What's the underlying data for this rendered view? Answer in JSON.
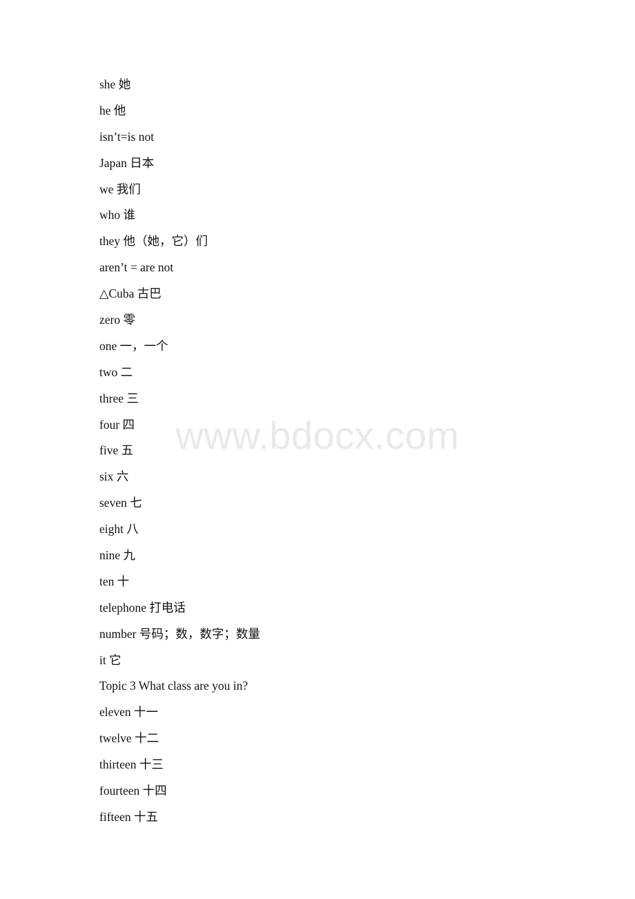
{
  "document": {
    "watermark": "www.bdocx.com",
    "lines": [
      {
        "text": "she 她"
      },
      {
        "text": "he 他"
      },
      {
        "text": "isn’t=is not"
      },
      {
        "text": "Japan 日本"
      },
      {
        "text": "we 我们"
      },
      {
        "text": "who 谁"
      },
      {
        "text": "they 他（她，它）们"
      },
      {
        "text": "aren’t = are not"
      },
      {
        "text": "△Cuba 古巴"
      },
      {
        "text": "zero 零"
      },
      {
        "text": "one 一，一个"
      },
      {
        "text": "two 二"
      },
      {
        "text": "three 三"
      },
      {
        "text": "four 四"
      },
      {
        "text": "five 五"
      },
      {
        "text": "six 六"
      },
      {
        "text": "seven 七"
      },
      {
        "text": "eight 八"
      },
      {
        "text": "nine 九"
      },
      {
        "text": "ten 十"
      },
      {
        "text": "telephone 打电话"
      },
      {
        "text": "number 号码；数，数字；数量"
      },
      {
        "text": "it 它"
      },
      {
        "text": "Topic 3 What class are you in?"
      },
      {
        "text": "eleven 十一"
      },
      {
        "text": "twelve 十二"
      },
      {
        "text": "thirteen 十三"
      },
      {
        "text": "fourteen 十四"
      },
      {
        "text": "fifteen 十五"
      }
    ]
  }
}
